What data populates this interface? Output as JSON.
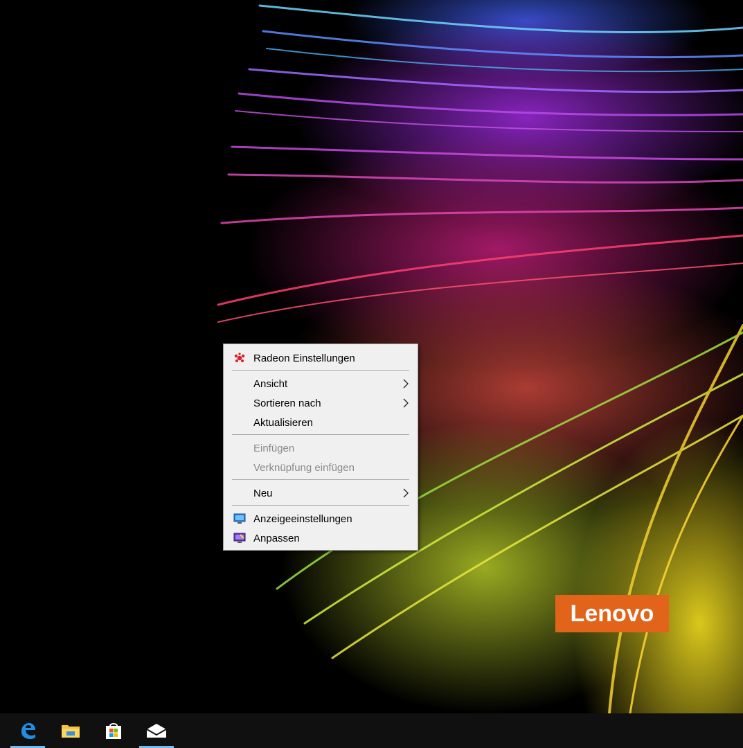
{
  "wallpaper": {
    "brand": "Lenovo"
  },
  "context_menu": {
    "items": [
      {
        "label": "Radeon Einstellungen",
        "icon": "radeon-icon",
        "enabled": true
      },
      {
        "label": "Ansicht",
        "submenu": true,
        "enabled": true
      },
      {
        "label": "Sortieren nach",
        "submenu": true,
        "enabled": true
      },
      {
        "label": "Aktualisieren",
        "enabled": true
      },
      {
        "label": "Einfügen",
        "enabled": false
      },
      {
        "label": "Verknüpfung einfügen",
        "enabled": false
      },
      {
        "label": "Neu",
        "submenu": true,
        "enabled": true
      },
      {
        "label": "Anzeigeeinstellungen",
        "icon": "display-settings-icon",
        "enabled": true
      },
      {
        "label": "Anpassen",
        "icon": "personalize-icon",
        "enabled": true
      }
    ]
  },
  "taskbar": {
    "pinned": [
      {
        "name": "edge-icon",
        "active": true
      },
      {
        "name": "file-explorer-icon",
        "active": false
      },
      {
        "name": "store-icon",
        "active": false
      },
      {
        "name": "mail-icon",
        "active": true
      }
    ],
    "colors": {
      "background": "#101010",
      "active_indicator": "#76b9ed"
    }
  },
  "colors": {
    "lenovo_orange": "#e2641a",
    "menu_bg": "#f0f0f0",
    "disabled_text": "#8a8a8a"
  }
}
